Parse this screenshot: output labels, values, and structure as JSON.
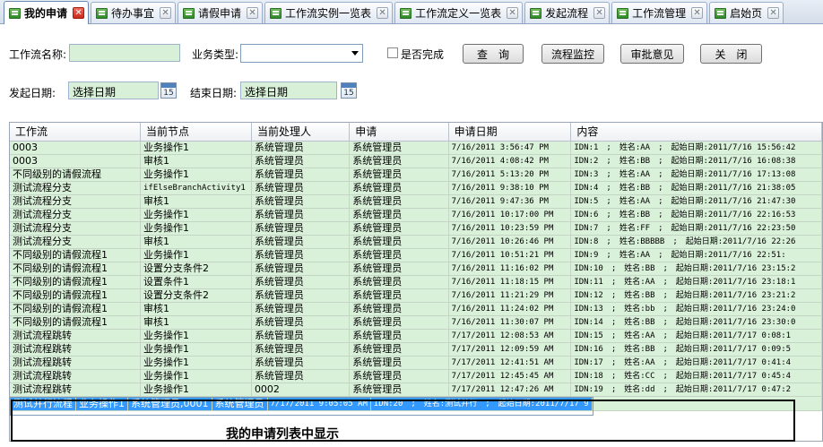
{
  "tabs": [
    {
      "label": "我的申请",
      "active": true
    },
    {
      "label": "待办事宜",
      "active": false
    },
    {
      "label": "请假申请",
      "active": false
    },
    {
      "label": "工作流实例一览表",
      "active": false
    },
    {
      "label": "工作流定义一览表",
      "active": false
    },
    {
      "label": "发起流程",
      "active": false
    },
    {
      "label": "工作流管理",
      "active": false
    },
    {
      "label": "启始页",
      "active": false
    }
  ],
  "filters": {
    "workflow_name_label": "工作流名称:",
    "workflow_name_value": "",
    "business_type_label": "业务类型:",
    "business_type_value": "",
    "completed_label": "是否完成",
    "start_date_label": "发起日期:",
    "start_date_value": "选择日期",
    "end_date_label": "结束日期:",
    "end_date_value": "选择日期",
    "calendar_day": "15"
  },
  "buttons": {
    "query": "查　询",
    "monitor": "流程监控",
    "opinion": "审批意见",
    "close": "关　闭"
  },
  "grid": {
    "columns": [
      "工作流",
      "当前节点",
      "当前处理人",
      "申请",
      "申请日期",
      "内容"
    ],
    "rows": [
      [
        "0003",
        "业务操作1",
        "系统管理员",
        "系统管理员",
        "7/16/2011 3:56:47 PM",
        "IDN:1　;　姓名:AA　;　起始日期:2011/7/16 15:56:42"
      ],
      [
        "0003",
        "审核1",
        "系统管理员",
        "系统管理员",
        "7/16/2011 4:08:42 PM",
        "IDN:2　;　姓名:BB　;　起始日期:2011/7/16 16:08:38"
      ],
      [
        "不同级别的请假流程",
        "业务操作1",
        "系统管理员",
        "系统管理员",
        "7/16/2011 5:13:20 PM",
        "IDN:3　;　姓名:AA　;　起始日期:2011/7/16 17:13:08"
      ],
      [
        "测试流程分支",
        "ifElseBranchActivity1",
        "系统管理员",
        "系统管理员",
        "7/16/2011 9:38:10 PM",
        "IDN:4　;　姓名:BB　;　起始日期:2011/7/16 21:38:05"
      ],
      [
        "测试流程分支",
        "审核1",
        "系统管理员",
        "系统管理员",
        "7/16/2011 9:47:36 PM",
        "IDN:5　;　姓名:AA　;　起始日期:2011/7/16 21:47:30"
      ],
      [
        "测试流程分支",
        "业务操作1",
        "系统管理员",
        "系统管理员",
        "7/16/2011 10:17:00 PM",
        "IDN:6　;　姓名:BB　;　起始日期:2011/7/16 22:16:53"
      ],
      [
        "测试流程分支",
        "业务操作1",
        "系统管理员",
        "系统管理员",
        "7/16/2011 10:23:59 PM",
        "IDN:7　;　姓名:FF　;　起始日期:2011/7/16 22:23:50"
      ],
      [
        "测试流程分支",
        "审核1",
        "系统管理员",
        "系统管理员",
        "7/16/2011 10:26:46 PM",
        "IDN:8　;　姓名:BBBBB　;　起始日期:2011/7/16 22:26"
      ],
      [
        "不同级别的请假流程1",
        "业务操作1",
        "系统管理员",
        "系统管理员",
        "7/16/2011 10:51:21 PM",
        "IDN:9　;　姓名:AA　;　起始日期:2011/7/16 22:51:"
      ],
      [
        "不同级别的请假流程1",
        "设置分支条件2",
        "系统管理员",
        "系统管理员",
        "7/16/2011 11:16:02 PM",
        "IDN:10　;　姓名:BB　;　起始日期:2011/7/16 23:15:2"
      ],
      [
        "不同级别的请假流程1",
        "设置条件1",
        "系统管理员",
        "系统管理员",
        "7/16/2011 11:18:15 PM",
        "IDN:11　;　姓名:AA　;　起始日期:2011/7/16 23:18:1"
      ],
      [
        "不同级别的请假流程1",
        "设置分支条件2",
        "系统管理员",
        "系统管理员",
        "7/16/2011 11:21:29 PM",
        "IDN:12　;　姓名:BB　;　起始日期:2011/7/16 23:21:2"
      ],
      [
        "不同级别的请假流程1",
        "审核1",
        "系统管理员",
        "系统管理员",
        "7/16/2011 11:24:02 PM",
        "IDN:13　;　姓名:bb　;　起始日期:2011/7/16 23:24:0"
      ],
      [
        "不同级别的请假流程1",
        "审核1",
        "系统管理员",
        "系统管理员",
        "7/16/2011 11:30:07 PM",
        "IDN:14　;　姓名:BB　;　起始日期:2011/7/16 23:30:0"
      ],
      [
        "测试流程跳转",
        "业务操作1",
        "系统管理员",
        "系统管理员",
        "7/17/2011 12:08:53 AM",
        "IDN:15　;　姓名:AA　;　起始日期:2011/7/17 0:08:1"
      ],
      [
        "测试流程跳转",
        "业务操作1",
        "系统管理员",
        "系统管理员",
        "7/17/2011 12:09:59 AM",
        "IDN:16　;　姓名:BB　;　起始日期:2011/7/17 0:09:5"
      ],
      [
        "测试流程跳转",
        "业务操作1",
        "系统管理员",
        "系统管理员",
        "7/17/2011 12:41:51 AM",
        "IDN:17　;　姓名:AA　;　起始日期:2011/7/17 0:41:4"
      ],
      [
        "测试流程跳转",
        "业务操作1",
        "系统管理员",
        "系统管理员",
        "7/17/2011 12:45:45 AM",
        "IDN:18　;　姓名:CC　;　起始日期:2011/7/17 0:45:4"
      ],
      [
        "测试流程跳转",
        "业务操作1",
        "0002",
        "系统管理员",
        "7/17/2011 12:47:26 AM",
        "IDN:19　;　姓名:dd　;　起始日期:2011/7/17 0:47:2"
      ],
      [
        "测试并行流程",
        "业务操作1",
        "系统管理员,0001",
        "系统管理员",
        "7/17/2011 9:05:05 AM",
        "IDN:20　;　姓名:测试并行　;　起始日期:2011/7/17 9"
      ]
    ],
    "selected_index": 19
  },
  "annotation": "我的申请列表中显示"
}
